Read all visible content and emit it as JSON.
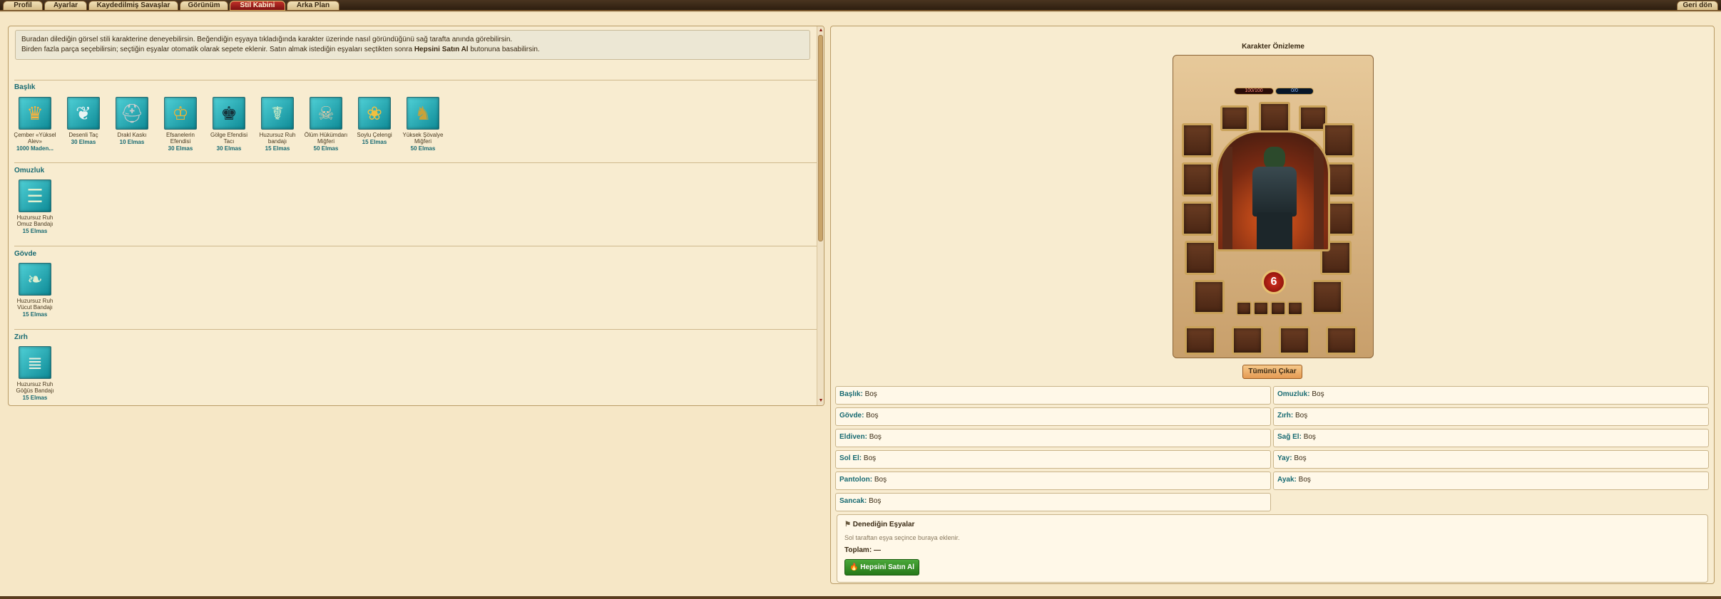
{
  "tabs": [
    {
      "label": "Profil",
      "active": false
    },
    {
      "label": "Ayarlar",
      "active": false
    },
    {
      "label": "Kaydedilmiş Savaşlar",
      "active": false
    },
    {
      "label": "Görünüm",
      "active": false
    },
    {
      "label": "Stil Kabini",
      "active": true
    },
    {
      "label": "Arka Plan",
      "active": false
    }
  ],
  "back_label": "Geri dön",
  "info": {
    "line1": "Buradan dilediğin görsel stili karakterine deneyebilirsin. Beğendiğin eşyaya tıkladığında karakter üzerinde nasıl göründüğünü sağ tarafta anında görebilirsin.",
    "line2_start": "Birden fazla parça seçebilirsin; seçtiğin eşyalar otomatik olarak sepete eklenir. Satın almak istediğin eşyaları seçtikten sonra ",
    "line2_bold": "Hepsini Satın Al",
    "line2_end": " butonuna basabilirsin."
  },
  "sections": [
    {
      "title": "Başlık",
      "items": [
        {
          "name": "Çember «Yüksel Alev»",
          "price": "1000 Maden...",
          "icon": "flame-crown-icon"
        },
        {
          "name": "Desenli Taç",
          "price": "30 Elmas",
          "icon": "feather-crown-icon"
        },
        {
          "name": "Drakl Kaskı",
          "price": "10 Elmas",
          "icon": "helmet-icon"
        },
        {
          "name": "Efsanelerin Efendisi",
          "price": "30 Elmas",
          "icon": "laurel-crown-icon"
        },
        {
          "name": "Gölge Efendisi Tacı",
          "price": "30 Elmas",
          "icon": "shadow-crown-icon"
        },
        {
          "name": "Huzursuz Ruh bandajı",
          "price": "15 Elmas",
          "icon": "bandage-head-icon"
        },
        {
          "name": "Ölüm Hükümdarı Miğferi",
          "price": "50 Elmas",
          "icon": "skull-helmet-icon"
        },
        {
          "name": "Soylu Çelengi",
          "price": "15 Elmas",
          "icon": "wreath-icon"
        },
        {
          "name": "Yüksek Şövalye Miğferi",
          "price": "50 Elmas",
          "icon": "knight-helmet-icon"
        }
      ]
    },
    {
      "title": "Omuzluk",
      "items": [
        {
          "name": "Huzursuz Ruh Omuz Bandajı",
          "price": "15 Elmas",
          "icon": "shoulder-bandage-icon"
        }
      ]
    },
    {
      "title": "Gövde",
      "items": [
        {
          "name": "Huzursuz Ruh Vücut Bandajı",
          "price": "15 Elmas",
          "icon": "body-bandage-icon"
        }
      ]
    },
    {
      "title": "Zırh",
      "items": [
        {
          "name": "Huzursuz Ruh Göğüs Bandajı",
          "price": "15 Elmas",
          "icon": "chest-bandage-icon"
        }
      ]
    }
  ],
  "preview": {
    "title": "Karakter Önizleme",
    "hp": "100/100",
    "mp": "0/0",
    "level": "6",
    "remove_all": "Tümünü Çıkar"
  },
  "equipment": [
    {
      "label": "Başlık:",
      "value": "Boş"
    },
    {
      "label": "Omuzluk:",
      "value": "Boş"
    },
    {
      "label": "Gövde:",
      "value": "Boş"
    },
    {
      "label": "Zırh:",
      "value": "Boş"
    },
    {
      "label": "Eldiven:",
      "value": "Boş"
    },
    {
      "label": "Sağ El:",
      "value": "Boş"
    },
    {
      "label": "Sol El:",
      "value": "Boş"
    },
    {
      "label": "Yay:",
      "value": "Boş"
    },
    {
      "label": "Pantolon:",
      "value": "Boş"
    },
    {
      "label": "Ayak:",
      "value": "Boş"
    },
    {
      "label": "Sancak:",
      "value": "Boş"
    }
  ],
  "tried": {
    "title": "Denediğin Eşyalar",
    "empty_text": "Sol taraftan eşya seçince buraya eklenir.",
    "total_label": "Toplam:",
    "total_value": "—",
    "buy_all": "Hepsini Satın Al"
  }
}
